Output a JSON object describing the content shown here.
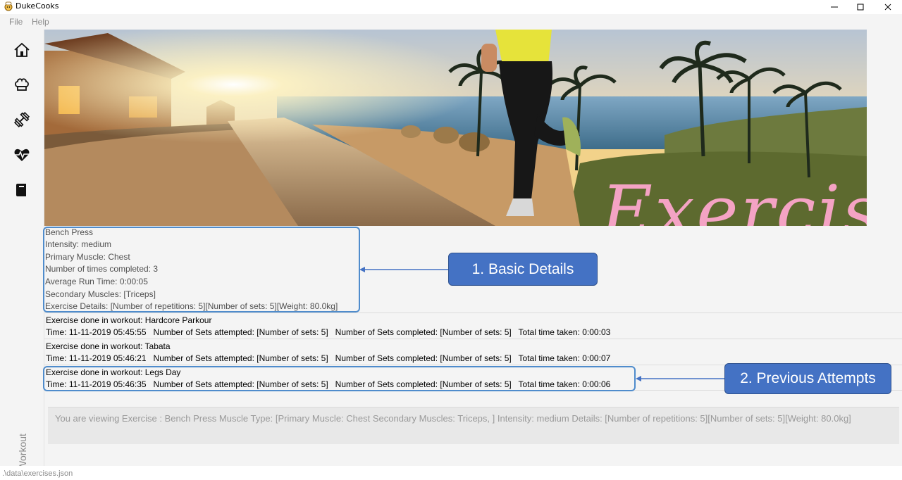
{
  "window": {
    "title": "DukeCooks",
    "controls": [
      "minimize-icon",
      "maximize-icon",
      "close-icon"
    ]
  },
  "menu": {
    "items": [
      "File",
      "Help"
    ]
  },
  "sidebar": {
    "items": [
      {
        "name": "home",
        "icon": "home-icon"
      },
      {
        "name": "recipes",
        "icon": "chef-hat-icon"
      },
      {
        "name": "workout",
        "icon": "dumbbell-icon"
      },
      {
        "name": "health",
        "icon": "heartbeat-icon"
      },
      {
        "name": "diary",
        "icon": "book-icon"
      }
    ],
    "current_page": "Workout"
  },
  "banner": {
    "title": "Exercise"
  },
  "exercise": {
    "name": "Bench Press",
    "intensity": "Intensity: medium",
    "primary_muscle": "Primary Muscle: Chest",
    "times_completed": "Number of times completed: 3",
    "average_run_time": "Average Run Time: 0:00:05",
    "secondary_muscles": "Secondary Muscles: [Triceps]",
    "details": "Exercise Details: [Number of repetitions: 5][Number of sets: 5][Weight: 80.0kg]"
  },
  "history": [
    {
      "workout": "Exercise done in workout: Hardcore Parkour",
      "summary": "Time: 11-11-2019 05:45:55   Number of Sets attempted: [Number of sets: 5]   Number of Sets completed: [Number of sets: 5]   Total time taken: 0:00:03"
    },
    {
      "workout": "Exercise done in workout: Tabata",
      "summary": "Time: 11-11-2019 05:46:21   Number of Sets attempted: [Number of sets: 5]   Number of Sets completed: [Number of sets: 5]   Total time taken: 0:00:07"
    },
    {
      "workout": "Exercise done in workout: Legs Day",
      "summary": "Time: 11-11-2019 05:46:35   Number of Sets attempted: [Number of sets: 5]   Number of Sets completed: [Number of sets: 5]   Total time taken: 0:00:06"
    }
  ],
  "result_display": "You are viewing Exercise : Bench Press Muscle Type:  [Primary Muscle: Chest Secondary Muscles: Triceps, ] Intensity: medium Details: [Number of repetitions: 5][Number of sets: 5][Weight: 80.0kg]",
  "status": {
    "path": ".\\data\\exercises.json"
  },
  "annotations": {
    "basic_details": "1. Basic Details",
    "previous_attempts": "2. Previous Attempts",
    "color": "#4472c4",
    "outline_color": "#4f8ccc"
  }
}
